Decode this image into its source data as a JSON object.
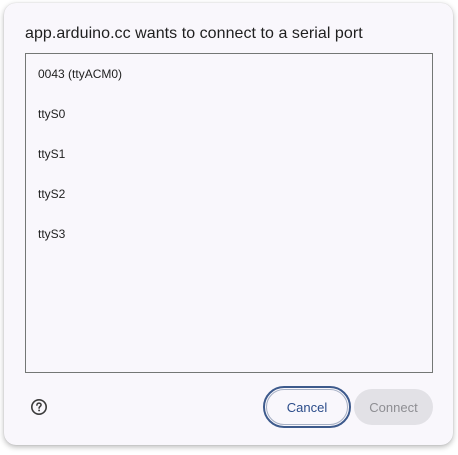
{
  "dialog": {
    "title": "app.arduino.cc wants to connect to a serial port",
    "ports": [
      {
        "label": "0043 (ttyACM0)"
      },
      {
        "label": "ttyS0"
      },
      {
        "label": "ttyS1"
      },
      {
        "label": "ttyS2"
      },
      {
        "label": "ttyS3"
      }
    ],
    "help_icon": "help-circle-icon",
    "cancel_label": "Cancel",
    "connect_label": "Connect",
    "connect_disabled": true
  },
  "colors": {
    "dialog_background": "#f9f7fc",
    "title_text": "#1f1f1f",
    "cancel_text": "#2b4c8a",
    "focus_ring": "#3d5a8c",
    "disabled_button_bg": "#e2e1e6",
    "disabled_button_text": "#8e8e93"
  }
}
